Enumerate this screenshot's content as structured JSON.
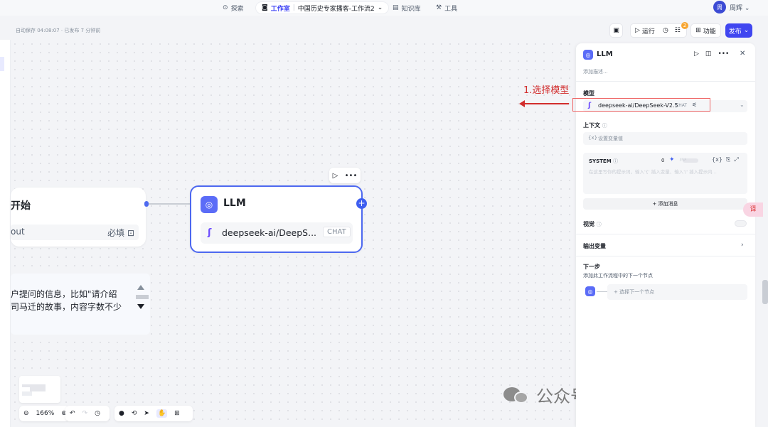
{
  "topnav": {
    "explore": "探索",
    "workspace": "工作室",
    "separator": "|",
    "workflow_name": "中国历史专家播客-工作流2",
    "knowledge": "知识库",
    "tools": "工具",
    "avatar_text": "周",
    "username": "周辉"
  },
  "toolbar": {
    "autosave": "自动保存 04:08:07 · 已发布 7 分钟前",
    "run": "运行",
    "badge_count": "2",
    "features": "功能",
    "publish": "发布"
  },
  "canvas": {
    "start_node": {
      "title": "开始",
      "row_label": "out",
      "row_required": "必填"
    },
    "llm_node": {
      "title": "LLM",
      "model": "deepseek-ai/DeepS...",
      "tag": "CHAT"
    },
    "text_node": {
      "line1": "户提问的信息，比如\"请介绍",
      "line2": "司马迁的故事，内容字数不少"
    },
    "zoom": "166%",
    "annotation": "1.选择模型"
  },
  "panel": {
    "title": "LLM",
    "description": "添加描述...",
    "model_label": "模型",
    "model_name": "deepseek-ai/DeepSeek-V2.5",
    "model_tag": "CHAT",
    "context_label": "上下文",
    "context_prefix": "{x}",
    "context_placeholder": "设置变量值",
    "system_label": "SYSTEM",
    "system_count": "0",
    "system_toggle_text": "JINJA",
    "system_placeholder": "在这里写你的提示词，输入'{' 插入变量、输入'/' 插入提示内...",
    "add_message": "+ 添加消息",
    "vision_label": "视觉",
    "output_label": "输出变量",
    "next_label": "下一步",
    "next_desc": "添加此工作流程中的下一个节点",
    "next_placeholder": "选择下一个节点"
  },
  "float_button": "译",
  "watermark": {
    "text": "公众号 · wwzhouhui"
  },
  "colors": {
    "accent": "#4046f0",
    "node_border": "#4d68f0",
    "annotation": "#d22d2d"
  }
}
